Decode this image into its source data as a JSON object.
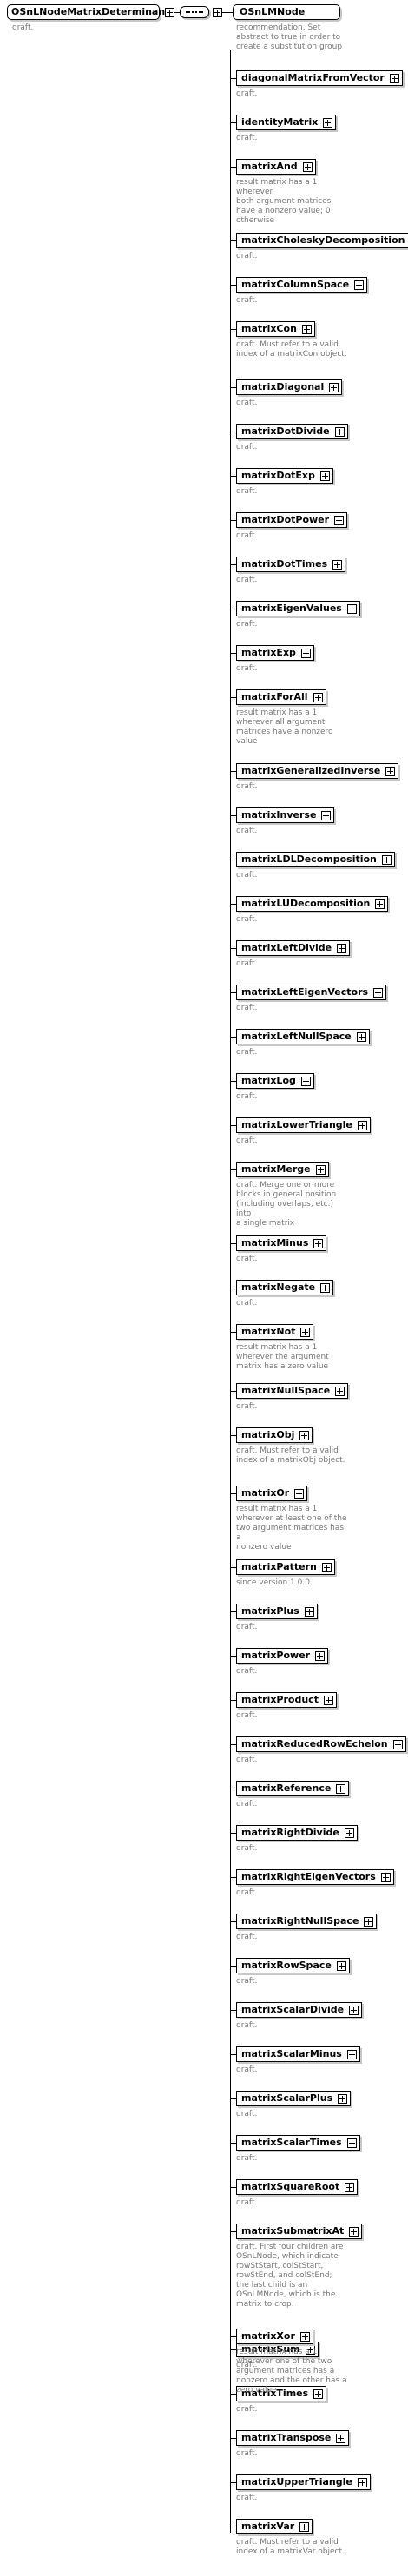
{
  "root": {
    "name": "OSnLNodeMatrixDeterminant",
    "doc": "draft."
  },
  "substitution_head": {
    "name": "OSnLMNode",
    "doc": "recommendation. Set abstract to true in order to create a substitution group"
  },
  "elements": [
    {
      "name": "diagonalMatrixFromVector",
      "doc": [
        "draft."
      ]
    },
    {
      "name": "identityMatrix",
      "doc": [
        "draft."
      ]
    },
    {
      "name": "matrixAnd",
      "doc": [
        "result matrix has a 1 wherever",
        "both argument matrices",
        "have a nonzero value; 0",
        "otherwise"
      ]
    },
    {
      "name": "matrixCholeskyDecomposition",
      "doc": [
        "draft."
      ]
    },
    {
      "name": "matrixColumnSpace",
      "doc": [
        "draft."
      ]
    },
    {
      "name": "matrixCon",
      "doc": [
        "draft. Must refer to a valid",
        "index of a matrixCon object."
      ]
    },
    {
      "name": "matrixDiagonal",
      "doc": [
        "draft."
      ]
    },
    {
      "name": "matrixDotDivide",
      "doc": [
        "draft."
      ]
    },
    {
      "name": "matrixDotExp",
      "doc": [
        "draft."
      ]
    },
    {
      "name": "matrixDotPower",
      "doc": [
        "draft."
      ]
    },
    {
      "name": "matrixDotTimes",
      "doc": [
        "draft."
      ]
    },
    {
      "name": "matrixEigenValues",
      "doc": [
        "draft."
      ]
    },
    {
      "name": "matrixExp",
      "doc": [
        "draft."
      ]
    },
    {
      "name": "matrixForAll",
      "doc": [
        "result matrix has a 1",
        "wherever all argument",
        "matrices have a nonzero",
        "value"
      ]
    },
    {
      "name": "matrixGeneralizedInverse",
      "doc": [
        "draft."
      ]
    },
    {
      "name": "matrixInverse",
      "doc": [
        "draft."
      ]
    },
    {
      "name": "matrixLDLDecomposition",
      "doc": [
        "draft."
      ]
    },
    {
      "name": "matrixLUDecomposition",
      "doc": [
        "draft."
      ]
    },
    {
      "name": "matrixLeftDivide",
      "doc": [
        "draft."
      ]
    },
    {
      "name": "matrixLeftEigenVectors",
      "doc": [
        "draft."
      ]
    },
    {
      "name": "matrixLeftNullSpace",
      "doc": [
        "draft."
      ]
    },
    {
      "name": "matrixLog",
      "doc": [
        "draft."
      ]
    },
    {
      "name": "matrixLowerTriangle",
      "doc": [
        "draft."
      ]
    },
    {
      "name": "matrixMerge",
      "doc": [
        "draft. Merge one or more",
        "blocks in general position",
        "(including overlaps, etc.) into",
        "a single matrix"
      ]
    },
    {
      "name": "matrixMinus",
      "doc": [
        "draft."
      ]
    },
    {
      "name": "matrixNegate",
      "doc": [
        "draft."
      ]
    },
    {
      "name": "matrixNot",
      "doc": [
        "result matrix has a 1",
        "wherever the argument",
        "matrix has a zero value"
      ]
    },
    {
      "name": "matrixNullSpace",
      "doc": [
        "draft."
      ]
    },
    {
      "name": "matrixObj",
      "doc": [
        "draft. Must refer to a valid",
        "index of a matrixObj object."
      ]
    },
    {
      "name": "matrixOr",
      "doc": [
        "result matrix has a 1",
        "wherever at least one of the",
        "two argument matrices has a",
        "nonzero value"
      ]
    },
    {
      "name": "matrixPattern",
      "doc": [
        "since version 1.0.0."
      ]
    },
    {
      "name": "matrixPlus",
      "doc": [
        "draft."
      ]
    },
    {
      "name": "matrixPower",
      "doc": [
        "draft."
      ]
    },
    {
      "name": "matrixProduct",
      "doc": [
        "draft."
      ]
    },
    {
      "name": "matrixReducedRowEchelon",
      "doc": [
        "draft."
      ]
    },
    {
      "name": "matrixReference",
      "doc": [
        "draft."
      ]
    },
    {
      "name": "matrixRightDivide",
      "doc": [
        "draft."
      ]
    },
    {
      "name": "matrixRightEigenVectors",
      "doc": [
        "draft."
      ]
    },
    {
      "name": "matrixRightNullSpace",
      "doc": [
        "draft."
      ]
    },
    {
      "name": "matrixRowSpace",
      "doc": [
        "draft."
      ]
    },
    {
      "name": "matrixScalarDivide",
      "doc": [
        "draft."
      ]
    },
    {
      "name": "matrixScalarMinus",
      "doc": [
        "draft."
      ]
    },
    {
      "name": "matrixScalarPlus",
      "doc": [
        "draft."
      ]
    },
    {
      "name": "matrixScalarTimes",
      "doc": [
        "draft."
      ]
    },
    {
      "name": "matrixSquareRoot",
      "doc": [
        "draft."
      ]
    },
    {
      "name": "matrixSubmatrixAt",
      "doc": [
        "draft. First four children are",
        "OSnLNode, which indicate",
        "rowStStart, colStStart,",
        "rowStEnd, and colStEnd;",
        "the last child is an",
        "OSnLMNode, which is the",
        "matrix to crop."
      ]
    },
    {
      "name": "matrixSum",
      "doc": [
        "draft."
      ]
    },
    {
      "name": "matrixTimes",
      "doc": [
        "draft."
      ]
    },
    {
      "name": "matrixTranspose",
      "doc": [
        "draft."
      ]
    },
    {
      "name": "matrixUpperTriangle",
      "doc": [
        "draft."
      ]
    },
    {
      "name": "matrixVar",
      "doc": [
        "draft. Must refer to a valid",
        "index of a matrixVar object."
      ]
    },
    {
      "name": "matrixXor",
      "doc": [
        "result matrix has a 1",
        "wherever one of the two",
        "argument matrices has a",
        "nonzero and the other has a",
        "zero value"
      ]
    }
  ]
}
